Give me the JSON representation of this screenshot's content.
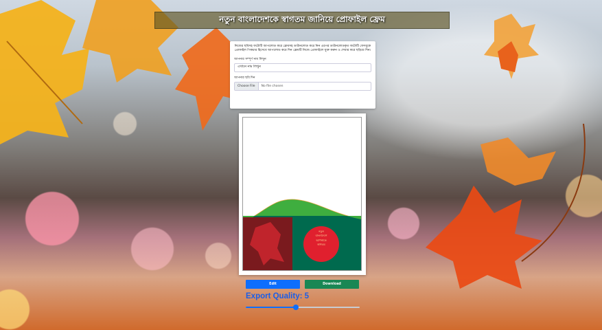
{
  "header": {
    "title": "নতুন বাংলাদেশকে স্বাগতম জানিয়ে প্রোফাইল ফ্রেম"
  },
  "form": {
    "instructions": "নিজের ছবিসহ ফটোটি আপলোড করে ফ্রেমসহ ডাউনলোড করে নিন এরপর ডাউনলোডকৃত ফটোটি ফেসবুকে প্রোফাইল পিকচার হিসেবে আপলোড করে দিন ফ্রেমটি নিজে প্রোফাইলে যুক্ত করুন ও শেয়ার করে ছড়িয়ে দিন।",
    "name_label": "আপনার সম্পূর্ণ নাম লিখুন",
    "name_value": "এখানে নাম লিখুন",
    "photo_label": "আপনার ছবি দিন",
    "file_button": "Choose File",
    "file_status": "No file chosen"
  },
  "frame": {
    "badge_text": [
      "নতুন",
      "বাংলাদেশে",
      "আপনাকে",
      "স্বাগতম"
    ]
  },
  "actions": {
    "edit_label": "Edit",
    "download_label": "Download"
  },
  "export": {
    "label": "Export Quality: 5",
    "value": 5,
    "max": 10,
    "fraction": 0.44
  },
  "colors": {
    "primary": "#0d6efd",
    "success": "#198754",
    "flag_green": "#006a4e",
    "flag_red": "#e0202e",
    "hill_green": "#3fae3f"
  },
  "icons": [
    "autumn-leaf-icon"
  ]
}
